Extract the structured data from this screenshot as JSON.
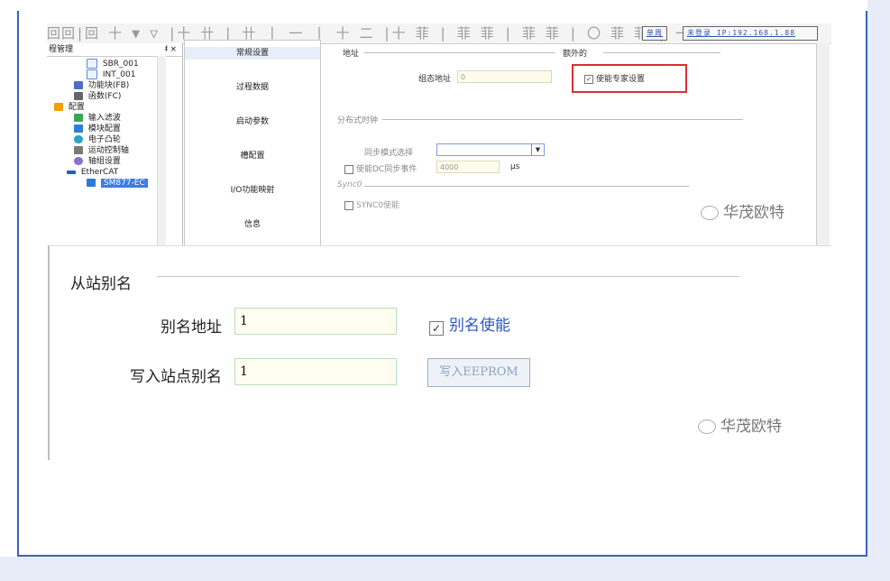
{
  "toolbar": {
    "glyphs": "回回|回 十 ▼ ▽ |十 卄 | 卄 丨 一 丨 十 二 |十 菲 | 菲 菲 | 菲 菲 | 〇 菲 菲 | 一 丨 フ ホ 丨 丨",
    "btn1": "单周",
    "btn2": "未登录 IP:192.168.1.88"
  },
  "tree": {
    "title": "程管理",
    "pin": "ᵮ ×",
    "items": [
      "SBR_001",
      "INT_001",
      "功能块(FB)",
      "函数(FC)",
      "配置",
      "输入滤波",
      "模块配置",
      "电子凸轮",
      "运动控制轴",
      "轴组设置",
      "EtherCAT",
      "SM877-EC"
    ]
  },
  "nav": {
    "items": [
      "常规设置",
      "过程数据",
      "启动参数",
      "槽配置",
      "I/O功能映射",
      "信息"
    ]
  },
  "settings": {
    "address_group": "地址",
    "extra_group": "额外的",
    "config_addr_label": "组态地址",
    "config_addr_value": "0",
    "vendor_chk": "使能专家设置",
    "dc_group": "分布式时钟",
    "sync_mode_label": "同步模式选择",
    "enable_dc_label": "使能DC同步事件",
    "dc_value": "4000",
    "dc_unit": "μs",
    "sync0_group": "Sync0",
    "sync0_chk": "SYNC0使能"
  },
  "right_panel": {
    "label": "工"
  },
  "watermark": {
    "text1": "华茂欧特",
    "text2": "华茂欧特"
  },
  "zoom": {
    "section_title": "从站别名",
    "alias_addr_label": "别名地址",
    "alias_addr_value": "1",
    "alias_enable_label": "别名使能",
    "write_alias_label": "写入站点别名",
    "write_alias_value": "1",
    "write_button": "写入EEPROM"
  }
}
